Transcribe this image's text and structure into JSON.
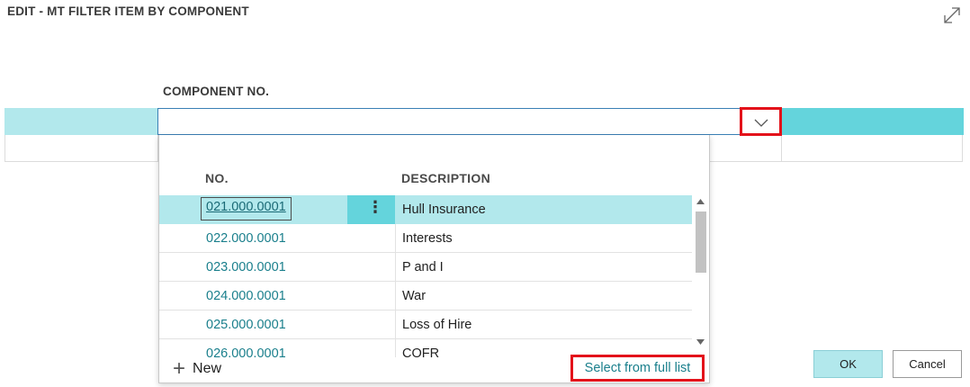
{
  "dialog": {
    "title": "EDIT - MT FILTER ITEM BY COMPONENT"
  },
  "field": {
    "label": "COMPONENT NO.",
    "value": "",
    "placeholder": ""
  },
  "lookup": {
    "columns": {
      "no": "NO.",
      "description": "DESCRIPTION"
    },
    "rows": [
      {
        "no": "021.000.0001",
        "description": "Hull Insurance",
        "selected": true
      },
      {
        "no": "022.000.0001",
        "description": "Interests"
      },
      {
        "no": "023.000.0001",
        "description": "P and I"
      },
      {
        "no": "024.000.0001",
        "description": "War"
      },
      {
        "no": "025.000.0001",
        "description": "Loss of Hire"
      },
      {
        "no": "026.000.0001",
        "description": "COFR"
      }
    ],
    "row_menu_glyph": "⋮",
    "new_label": "New",
    "new_glyph": "+",
    "select_full_label": "Select from full list"
  },
  "buttons": {
    "ok": "OK",
    "cancel": "Cancel"
  },
  "icons": {
    "expand": "expand-icon",
    "dropdown": "chevron-down-icon",
    "scroll_up": "scroll-up-icon",
    "scroll_down": "scroll-down-icon",
    "row_menu": "more-vertical-icon",
    "new": "plus-icon"
  },
  "colors": {
    "accent_light": "#b2e8ec",
    "accent": "#64d4dc",
    "link": "#1a7f8c",
    "highlight_border": "#e3121a"
  }
}
